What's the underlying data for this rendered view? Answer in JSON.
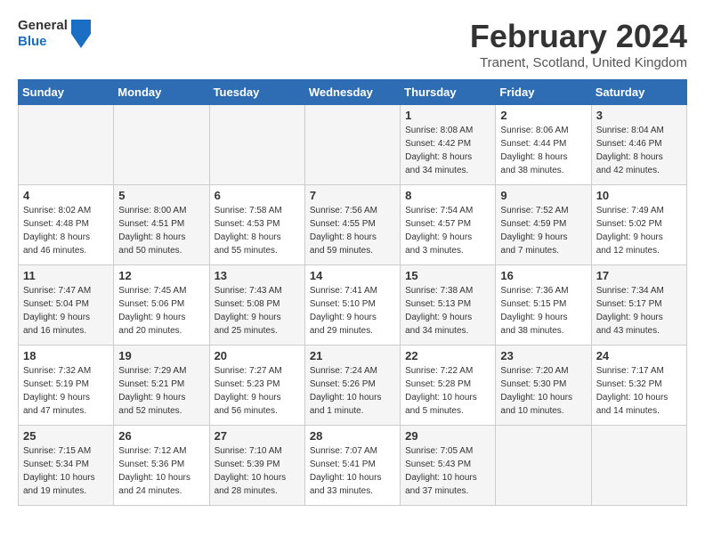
{
  "header": {
    "logo_general": "General",
    "logo_blue": "Blue",
    "month_title": "February 2024",
    "location": "Tranent, Scotland, United Kingdom"
  },
  "days_of_week": [
    "Sunday",
    "Monday",
    "Tuesday",
    "Wednesday",
    "Thursday",
    "Friday",
    "Saturday"
  ],
  "weeks": [
    [
      {
        "day": "",
        "info": ""
      },
      {
        "day": "",
        "info": ""
      },
      {
        "day": "",
        "info": ""
      },
      {
        "day": "",
        "info": ""
      },
      {
        "day": "1",
        "info": "Sunrise: 8:08 AM\nSunset: 4:42 PM\nDaylight: 8 hours\nand 34 minutes."
      },
      {
        "day": "2",
        "info": "Sunrise: 8:06 AM\nSunset: 4:44 PM\nDaylight: 8 hours\nand 38 minutes."
      },
      {
        "day": "3",
        "info": "Sunrise: 8:04 AM\nSunset: 4:46 PM\nDaylight: 8 hours\nand 42 minutes."
      }
    ],
    [
      {
        "day": "4",
        "info": "Sunrise: 8:02 AM\nSunset: 4:48 PM\nDaylight: 8 hours\nand 46 minutes."
      },
      {
        "day": "5",
        "info": "Sunrise: 8:00 AM\nSunset: 4:51 PM\nDaylight: 8 hours\nand 50 minutes."
      },
      {
        "day": "6",
        "info": "Sunrise: 7:58 AM\nSunset: 4:53 PM\nDaylight: 8 hours\nand 55 minutes."
      },
      {
        "day": "7",
        "info": "Sunrise: 7:56 AM\nSunset: 4:55 PM\nDaylight: 8 hours\nand 59 minutes."
      },
      {
        "day": "8",
        "info": "Sunrise: 7:54 AM\nSunset: 4:57 PM\nDaylight: 9 hours\nand 3 minutes."
      },
      {
        "day": "9",
        "info": "Sunrise: 7:52 AM\nSunset: 4:59 PM\nDaylight: 9 hours\nand 7 minutes."
      },
      {
        "day": "10",
        "info": "Sunrise: 7:49 AM\nSunset: 5:02 PM\nDaylight: 9 hours\nand 12 minutes."
      }
    ],
    [
      {
        "day": "11",
        "info": "Sunrise: 7:47 AM\nSunset: 5:04 PM\nDaylight: 9 hours\nand 16 minutes."
      },
      {
        "day": "12",
        "info": "Sunrise: 7:45 AM\nSunset: 5:06 PM\nDaylight: 9 hours\nand 20 minutes."
      },
      {
        "day": "13",
        "info": "Sunrise: 7:43 AM\nSunset: 5:08 PM\nDaylight: 9 hours\nand 25 minutes."
      },
      {
        "day": "14",
        "info": "Sunrise: 7:41 AM\nSunset: 5:10 PM\nDaylight: 9 hours\nand 29 minutes."
      },
      {
        "day": "15",
        "info": "Sunrise: 7:38 AM\nSunset: 5:13 PM\nDaylight: 9 hours\nand 34 minutes."
      },
      {
        "day": "16",
        "info": "Sunrise: 7:36 AM\nSunset: 5:15 PM\nDaylight: 9 hours\nand 38 minutes."
      },
      {
        "day": "17",
        "info": "Sunrise: 7:34 AM\nSunset: 5:17 PM\nDaylight: 9 hours\nand 43 minutes."
      }
    ],
    [
      {
        "day": "18",
        "info": "Sunrise: 7:32 AM\nSunset: 5:19 PM\nDaylight: 9 hours\nand 47 minutes."
      },
      {
        "day": "19",
        "info": "Sunrise: 7:29 AM\nSunset: 5:21 PM\nDaylight: 9 hours\nand 52 minutes."
      },
      {
        "day": "20",
        "info": "Sunrise: 7:27 AM\nSunset: 5:23 PM\nDaylight: 9 hours\nand 56 minutes."
      },
      {
        "day": "21",
        "info": "Sunrise: 7:24 AM\nSunset: 5:26 PM\nDaylight: 10 hours\nand 1 minute."
      },
      {
        "day": "22",
        "info": "Sunrise: 7:22 AM\nSunset: 5:28 PM\nDaylight: 10 hours\nand 5 minutes."
      },
      {
        "day": "23",
        "info": "Sunrise: 7:20 AM\nSunset: 5:30 PM\nDaylight: 10 hours\nand 10 minutes."
      },
      {
        "day": "24",
        "info": "Sunrise: 7:17 AM\nSunset: 5:32 PM\nDaylight: 10 hours\nand 14 minutes."
      }
    ],
    [
      {
        "day": "25",
        "info": "Sunrise: 7:15 AM\nSunset: 5:34 PM\nDaylight: 10 hours\nand 19 minutes."
      },
      {
        "day": "26",
        "info": "Sunrise: 7:12 AM\nSunset: 5:36 PM\nDaylight: 10 hours\nand 24 minutes."
      },
      {
        "day": "27",
        "info": "Sunrise: 7:10 AM\nSunset: 5:39 PM\nDaylight: 10 hours\nand 28 minutes."
      },
      {
        "day": "28",
        "info": "Sunrise: 7:07 AM\nSunset: 5:41 PM\nDaylight: 10 hours\nand 33 minutes."
      },
      {
        "day": "29",
        "info": "Sunrise: 7:05 AM\nSunset: 5:43 PM\nDaylight: 10 hours\nand 37 minutes."
      },
      {
        "day": "",
        "info": ""
      },
      {
        "day": "",
        "info": ""
      }
    ]
  ]
}
